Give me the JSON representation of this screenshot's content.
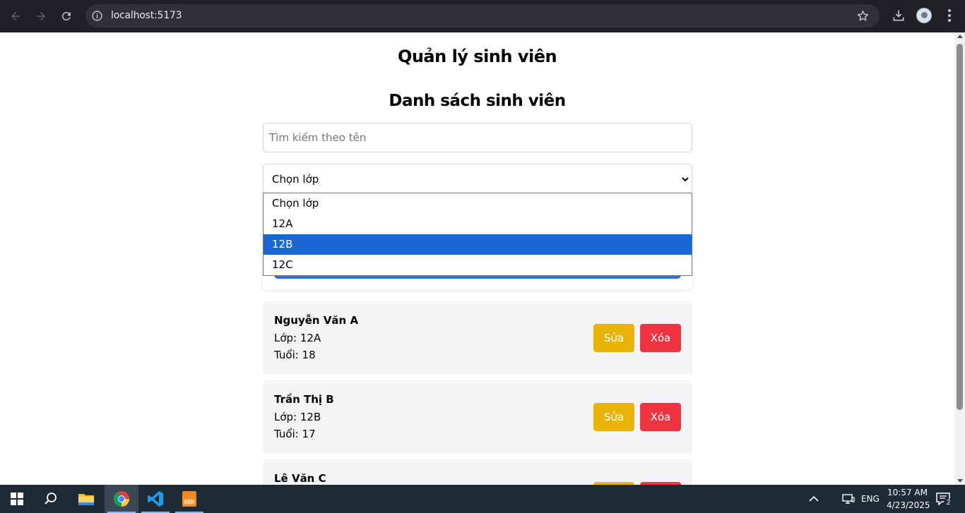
{
  "browser": {
    "url": "localhost:5173"
  },
  "page": {
    "app_title": "Quản lý sinh viên",
    "list_title": "Danh sách sinh viên",
    "search": {
      "placeholder": "Tìm kiếm theo tên",
      "value": ""
    },
    "class_select": {
      "selected": "Chọn lớp",
      "options": [
        "Chọn lớp",
        "12A",
        "12B",
        "12C"
      ],
      "highlighted": "12B"
    },
    "students": [
      {
        "name": "Nguyễn Văn A",
        "class_label": "Lớp: 12A",
        "age_label": "Tuổi: 18",
        "edit_label": "Sửa",
        "delete_label": "Xóa"
      },
      {
        "name": "Trần Thị B",
        "class_label": "Lớp: 12B",
        "age_label": "Tuổi: 17",
        "edit_label": "Sửa",
        "delete_label": "Xóa"
      },
      {
        "name": "Lê Văn C",
        "class_label": "",
        "age_label": "",
        "edit_label": "",
        "delete_label": ""
      }
    ],
    "colors": {
      "edit": "#eab308",
      "delete": "#ef3340",
      "highlight": "#1967d2",
      "primary": "#2b73d9"
    }
  },
  "taskbar": {
    "language": "ENG",
    "time": "10:57 AM",
    "date": "4/23/2025",
    "notification_count": "2",
    "apps": [
      "windows-start-icon",
      "search-icon",
      "file-explorer-icon",
      "chrome-icon",
      "vscode-icon",
      "pdf-icon"
    ]
  }
}
